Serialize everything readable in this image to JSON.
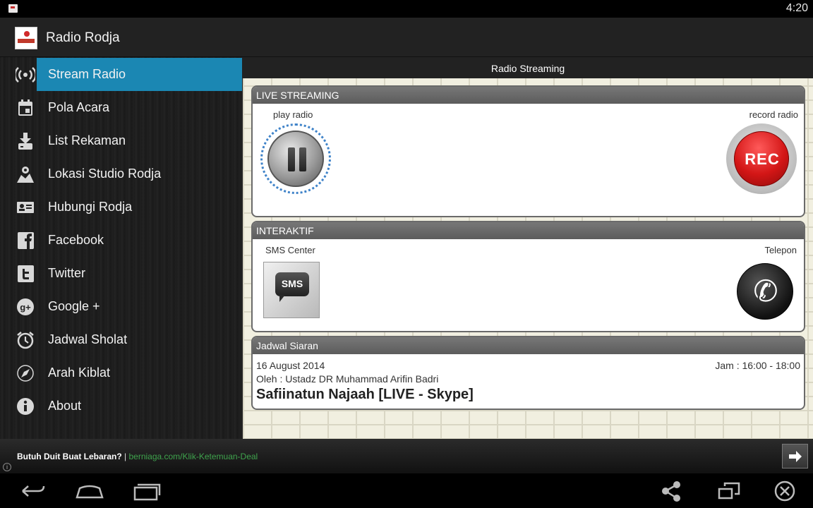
{
  "status_bar": {
    "time": "4:20"
  },
  "app": {
    "title": "Radio Rodja"
  },
  "drawer": {
    "items": [
      {
        "label": "Stream Radio",
        "icon": "radio-waves-icon",
        "active": true
      },
      {
        "label": "Pola Acara",
        "icon": "calendar-icon",
        "active": false
      },
      {
        "label": "List Rekaman",
        "icon": "download-icon",
        "active": false
      },
      {
        "label": "Lokasi Studio Rodja",
        "icon": "map-pin-icon",
        "active": false
      },
      {
        "label": "Hubungi Rodja",
        "icon": "contact-card-icon",
        "active": false
      },
      {
        "label": "Facebook",
        "icon": "facebook-icon",
        "active": false
      },
      {
        "label": "Twitter",
        "icon": "twitter-icon",
        "active": false
      },
      {
        "label": "Google +",
        "icon": "google-plus-icon",
        "active": false
      },
      {
        "label": "Jadwal Sholat",
        "icon": "alarm-clock-icon",
        "active": false
      },
      {
        "label": "Arah Kiblat",
        "icon": "compass-icon",
        "active": false
      },
      {
        "label": "About",
        "icon": "info-icon",
        "active": false
      }
    ]
  },
  "content": {
    "title": "Radio Streaming",
    "live": {
      "heading": "LIVE STREAMING",
      "play_label": "play radio",
      "record_label": "record radio",
      "record_button_text": "REC"
    },
    "interaktif": {
      "heading": "INTERAKTIF",
      "sms_label": "SMS Center",
      "sms_button_text": "SMS",
      "phone_label": "Telepon"
    },
    "schedule": {
      "heading": "Jadwal Siaran",
      "date": "16 August 2014",
      "time": "Jam : 16:00 - 18:00",
      "host": "Oleh :  Ustadz DR Muhammad Arifin Badri",
      "title": "Safiinatun Najaah [LIVE - Skype]"
    }
  },
  "ad": {
    "headline": "Butuh Duit Buat Lebaran?",
    "separator": " | ",
    "link": "berniaga.com/Klik-Ketemuan-Deal",
    "info": "i"
  },
  "colors": {
    "accent": "#1b87b3",
    "rec_red": "#d31616",
    "ad_link": "#3fa34d"
  }
}
